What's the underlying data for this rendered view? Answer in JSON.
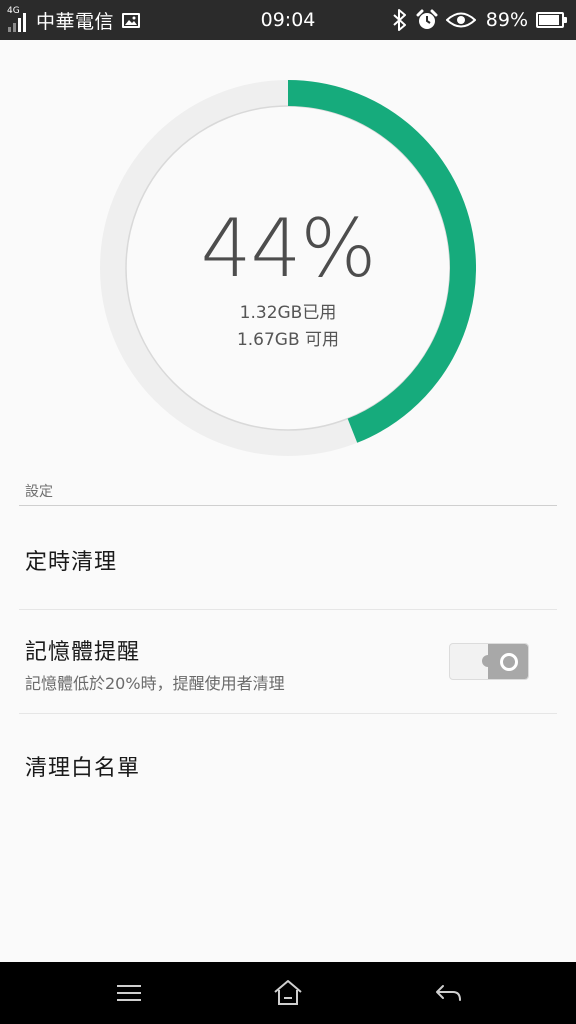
{
  "status_bar": {
    "network_type": "4G",
    "carrier": "中華電信",
    "time": "09:04",
    "battery_percent_text": "89%",
    "battery_level": 0.89,
    "icons": [
      "signal-icon",
      "gallery-icon",
      "bluetooth-icon",
      "alarm-icon",
      "eye-icon",
      "battery-icon"
    ]
  },
  "memory_gauge": {
    "percent_text": "44%",
    "used_text": "1.32GB已用",
    "available_text": "1.67GB 可用",
    "used_fraction": 0.44,
    "colors": {
      "used": "#16ab7c",
      "track": "#efefef",
      "track_inner": "#d9d9d9"
    }
  },
  "settings": {
    "section_header": "設定",
    "items": [
      {
        "title": "定時清理"
      },
      {
        "title": "記憶體提醒",
        "subtitle": "記憶體低於20%時，提醒使用者清理",
        "toggle_on": false
      },
      {
        "title": "清理白名單"
      }
    ]
  },
  "nav_bar": {
    "buttons": [
      "menu-icon",
      "home-icon",
      "back-icon"
    ]
  }
}
